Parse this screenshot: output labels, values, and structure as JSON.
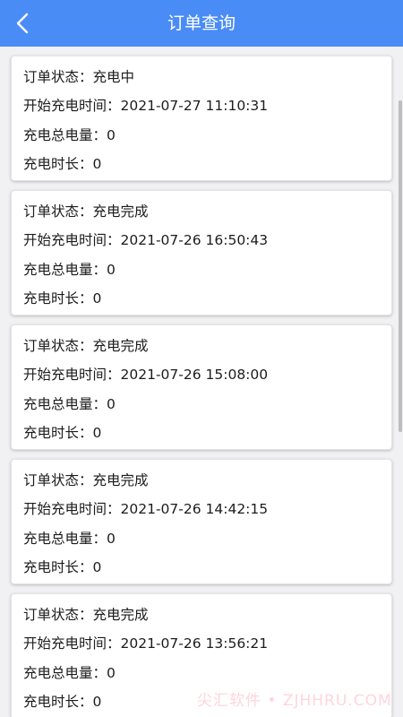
{
  "header": {
    "title": "订单查询",
    "back_icon": "chevron-left-icon",
    "background": "#4a8cf5"
  },
  "orders": [
    {
      "status": "订单状态：充电中",
      "start_time": "开始充电时间：2021-07-27 11:10:31",
      "total_energy": "充电总电量：0",
      "duration": "充电时长：0"
    },
    {
      "status": "订单状态：充电完成",
      "start_time": "开始充电时间：2021-07-26 16:50:43",
      "total_energy": "充电总电量：0",
      "duration": "充电时长：0"
    },
    {
      "status": "订单状态：充电完成",
      "start_time": "开始充电时间：2021-07-26 15:08:00",
      "total_energy": "充电总电量：0",
      "duration": "充电时长：0"
    },
    {
      "status": "订单状态：充电完成",
      "start_time": "开始充电时间：2021-07-26 14:42:15",
      "total_energy": "充电总电量：0",
      "duration": "充电时长：0"
    },
    {
      "status": "订单状态：充电完成",
      "start_time": "开始充电时间：2021-07-26 13:56:21",
      "total_energy": "充电总电量：0",
      "duration": "充电时长：0"
    }
  ],
  "watermark": "尖汇软件 • ZJHHRU.COM"
}
